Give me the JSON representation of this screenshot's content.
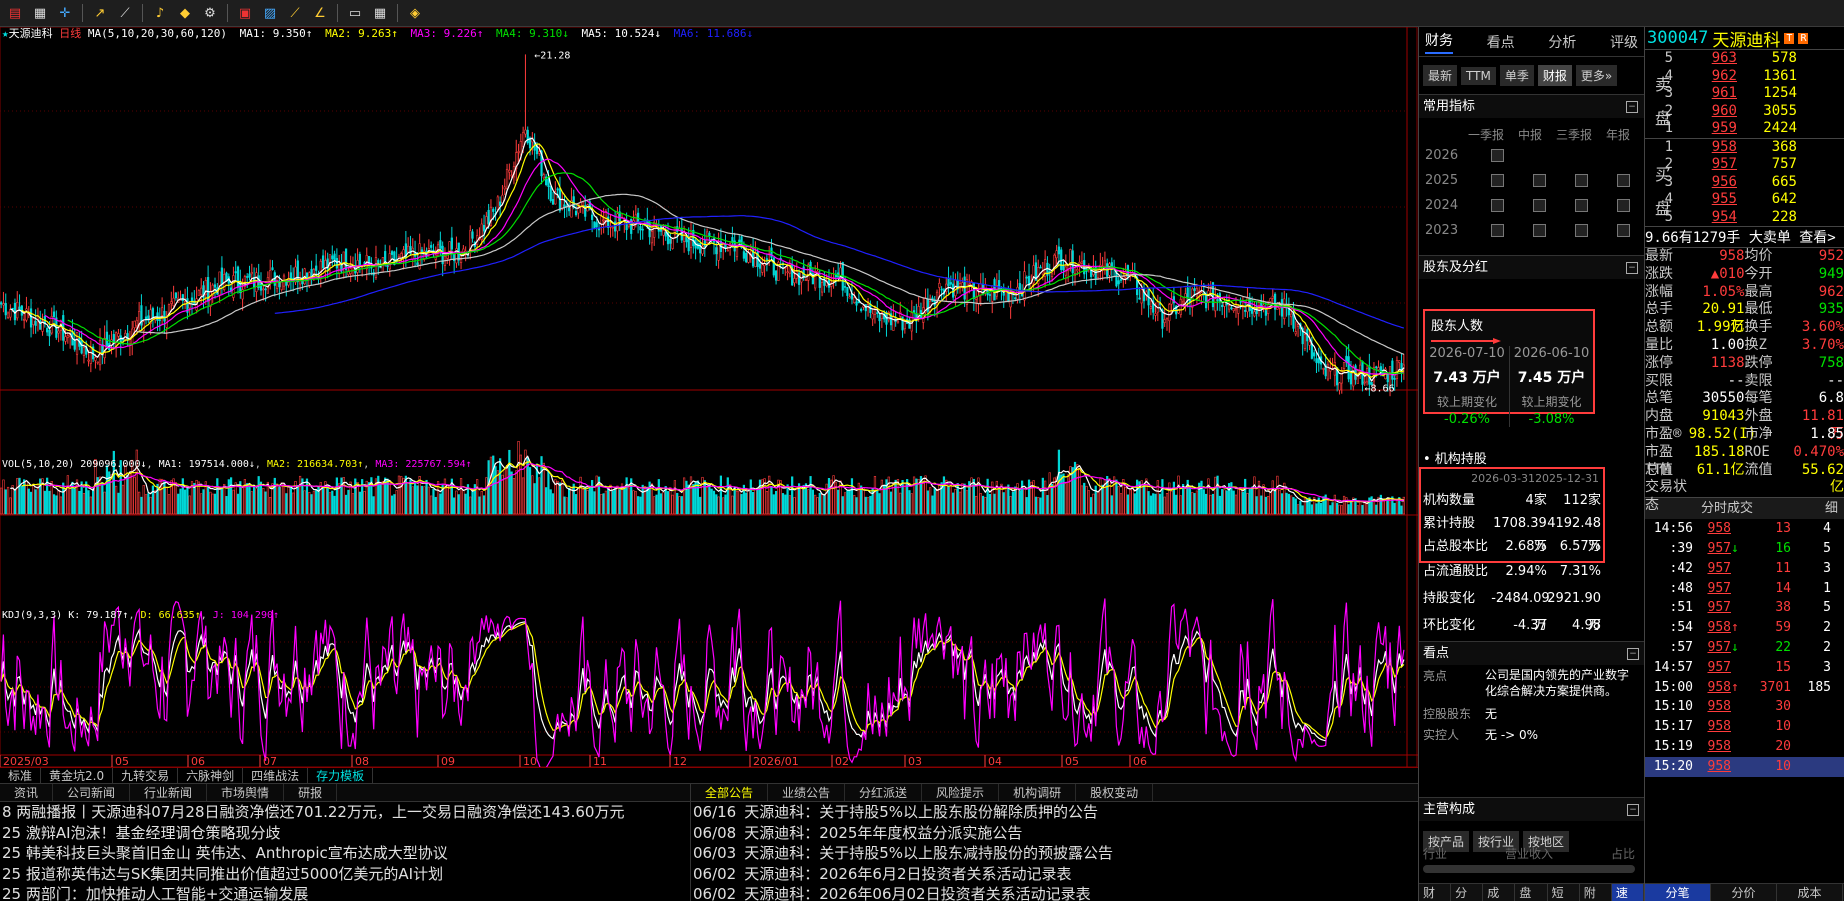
{
  "toolbar": {
    "icons": [
      "app-logo-icon",
      "calendar-icon",
      "crosshair-icon",
      "arrow-icon",
      "line-tool-icon",
      "bell-icon",
      "alarm-icon",
      "settings-icon",
      "grid-icon",
      "picture-icon",
      "line-chart-icon",
      "channel-icon",
      "window-icon",
      "layout-icon",
      "diamond-icon"
    ]
  },
  "chart": {
    "title": "天源迪科",
    "period": "日线",
    "ma_params": "MA(5,10,20,30,60,120)",
    "ma1": "MA1: 9.350↑",
    "ma2": "MA2: 9.263↑",
    "ma3": "MA3: 9.226↑",
    "ma4": "MA4: 9.310↓",
    "ma5": "MA5: 10.524↓",
    "ma6": "MA6: 11.686↓",
    "high_label": "21.28",
    "low_label": "8.66",
    "vol_params": "VOL(5,10,20)",
    "vol_val": "209096.000↓",
    "vma1": "MA1: 197514.000↓",
    "vma2": "MA2: 216634.703↑",
    "vma3": "MA3: 225767.594↑",
    "kdj_params": "KDJ(9,3,3)",
    "kdj_k": "K: 79.187↑",
    "kdj_d": "D: 66.635↑",
    "kdj_j": "J: 104.290↑",
    "months": [
      "2025/03",
      "05",
      "06",
      "07",
      "08",
      "09",
      "10",
      "11",
      "12",
      "2026/01",
      "02",
      "03",
      "04",
      "05",
      "06"
    ]
  },
  "subbar": [
    "标准",
    "黄金坑2.0",
    "九转交易",
    "六脉神剑",
    "四维战法",
    "存力模板"
  ],
  "news_left": {
    "tabs": [
      "资讯",
      "公司新闻",
      "行业新闻",
      "市场舆情",
      "研报"
    ],
    "items": [
      "8 两融播报丨天源迪科07月28日融资净偿还701.22万元，上一交易日融资净偿还143.60万元",
      "25 激辩AI泡沫！基金经理调仓策略现分歧",
      "25 韩美科技巨头聚首旧金山 英伟达、Anthropic宣布达成大型协议",
      "25 报道称英伟达与SK集团共同推出价值超过5000亿美元的AI计划",
      "25 两部门：加快推动人工智能+交通运输发展"
    ]
  },
  "news_right": {
    "tabs": [
      "全部公告",
      "业绩公告",
      "分红派送",
      "风险提示",
      "机构调研",
      "股权变动"
    ],
    "items": [
      {
        "d": "06/16",
        "t": "天源迪科：关于持股5%以上股东股份解除质押的公告"
      },
      {
        "d": "06/08",
        "t": "天源迪科：2025年年度权益分派实施公告"
      },
      {
        "d": "06/03",
        "t": "天源迪科：关于持股5%以上股东减持股份的预披露公告"
      },
      {
        "d": "06/02",
        "t": "天源迪科：2026年6月2日投资者关系活动记录表"
      },
      {
        "d": "06/02",
        "t": "天源迪科：2026年06月02日投资者关系活动记录表"
      }
    ]
  },
  "mid": {
    "tabs": [
      "财务",
      "看点",
      "分析",
      "评级"
    ],
    "subtabs": [
      "最新",
      "TTM",
      "单季",
      "财报",
      "更多»"
    ],
    "indicators_title": "常用指标",
    "report_hdr": [
      "一季报",
      "中报",
      "三季报",
      "年报"
    ],
    "years": [
      "2026",
      "2025",
      "2024",
      "2023"
    ],
    "holders_title": "股东及分红",
    "holders_box_title": "股东人数",
    "h_dates": [
      "2026-07-10",
      "2026-06-10"
    ],
    "h_vals": [
      "7.43 万户",
      "7.45 万户"
    ],
    "h_change_label": "较上期变化",
    "h_changes": [
      "-0.26%",
      "-3.08%"
    ],
    "inst_title": "• 机构持股",
    "inst_dates": [
      "2026-03-31",
      "2025-12-31"
    ],
    "inst_rows": [
      {
        "k": "机构数量",
        "a": "4家",
        "b": "112家"
      },
      {
        "k": "累计持股",
        "a": "1708.39万",
        "b": "4192.48万"
      },
      {
        "k": "占总股本比",
        "a": "2.68%",
        "b": "6.57%"
      },
      {
        "k": "占流通股比",
        "a": "2.94%",
        "b": "7.31%"
      },
      {
        "k": "持股变化",
        "a": "-2484.09万",
        "b": "2921.90万"
      },
      {
        "k": "环比变化",
        "a": "-4.37",
        "b": "4.98"
      }
    ],
    "view_title": "看点",
    "view_k1": "亮点",
    "view_v1": "公司是国内领先的产业数字化综合解决方案提供商。",
    "view_k2": "控股股东",
    "view_v2": "无",
    "view_k3": "实控人",
    "view_v3": "无 -> 0%",
    "biz_title": "主营构成",
    "biz_tabs": [
      "按产品",
      "按行业",
      "按地区"
    ],
    "biz_hdr": [
      "行业",
      "营业收入",
      "占比"
    ],
    "bottom": [
      "财务",
      "分价",
      "成本",
      "盘口",
      "短线",
      "附图",
      "速递"
    ]
  },
  "right": {
    "code": "300047",
    "name": "天源迪科",
    "tags": [
      "T",
      "R"
    ],
    "sell_label": [
      "卖",
      "盘"
    ],
    "buy_label": [
      "买",
      "盘"
    ],
    "asks": [
      {
        "l": "5",
        "p": "963",
        "v": "578"
      },
      {
        "l": "4",
        "p": "962",
        "v": "1361"
      },
      {
        "l": "3",
        "p": "961",
        "v": "1254"
      },
      {
        "l": "2",
        "p": "960",
        "v": "3055"
      },
      {
        "l": "1",
        "p": "959",
        "v": "2424"
      }
    ],
    "bids": [
      {
        "l": "1",
        "p": "958",
        "v": "368"
      },
      {
        "l": "2",
        "p": "957",
        "v": "757"
      },
      {
        "l": "3",
        "p": "956",
        "v": "665"
      },
      {
        "l": "4",
        "p": "955",
        "v": "642"
      },
      {
        "l": "5",
        "p": "954",
        "v": "228"
      }
    ],
    "alert": "9.66有1279手 大卖单 查看>",
    "quotes": [
      [
        "最新",
        "958",
        "均价",
        "952"
      ],
      [
        "涨跌",
        "▲010",
        "今开",
        "949"
      ],
      [
        "涨幅",
        "1.05%",
        "最高",
        "962"
      ],
      [
        "总手",
        "20.91万",
        "最低",
        "935"
      ],
      [
        "总额",
        "1.99亿",
        "换手",
        "3.60%"
      ],
      [
        "量比",
        "1.00",
        "换Z",
        "3.70%"
      ],
      [
        "涨停",
        "1138",
        "跌停",
        "758"
      ],
      [
        "买限",
        "--",
        "卖限",
        "--"
      ],
      [
        "总笔",
        "30550",
        "每笔",
        "6.8"
      ],
      [
        "内盘",
        "91043",
        "外盘",
        "11.81万"
      ],
      [
        "市盈®",
        "98.52(I)",
        "市净",
        "1.85"
      ],
      [
        "市盈TTM",
        "185.18",
        "ROE",
        "0.470%"
      ],
      [
        "总值",
        "61.1亿",
        "流值",
        "55.62亿"
      ],
      [
        "交易状态",
        "",
        "",
        ""
      ]
    ],
    "ticks_title": "分时成交",
    "ticks_btn": "细",
    "ticks": [
      {
        "t": "14:56",
        "p": "958",
        "a": "",
        "v": "13",
        "n": "4"
      },
      {
        "t": ":39",
        "p": "957",
        "a": "↓",
        "v": "16",
        "n": "5"
      },
      {
        "t": ":42",
        "p": "957",
        "a": "",
        "v": "11",
        "n": "3"
      },
      {
        "t": ":48",
        "p": "957",
        "a": "",
        "v": "14",
        "n": "1"
      },
      {
        "t": ":51",
        "p": "957",
        "a": "",
        "v": "38",
        "n": "5"
      },
      {
        "t": ":54",
        "p": "958",
        "a": "↑",
        "v": "59",
        "n": "2"
      },
      {
        "t": ":57",
        "p": "957",
        "a": "↓",
        "v": "22",
        "n": "2"
      },
      {
        "t": "14:57",
        "p": "957",
        "a": "",
        "v": "15",
        "n": "3"
      },
      {
        "t": "15:00",
        "p": "958",
        "a": "↑",
        "v": "3701",
        "n": "185"
      },
      {
        "t": "15:10",
        "p": "958",
        "a": "",
        "v": "30",
        "n": ""
      },
      {
        "t": "15:17",
        "p": "958",
        "a": "",
        "v": "10",
        "n": ""
      },
      {
        "t": "15:19",
        "p": "958",
        "a": "",
        "v": "20",
        "n": ""
      },
      {
        "t": "15:20",
        "p": "958",
        "a": "",
        "v": "10",
        "n": ""
      }
    ],
    "bottom": [
      "分笔",
      "分价",
      "成本"
    ]
  }
}
